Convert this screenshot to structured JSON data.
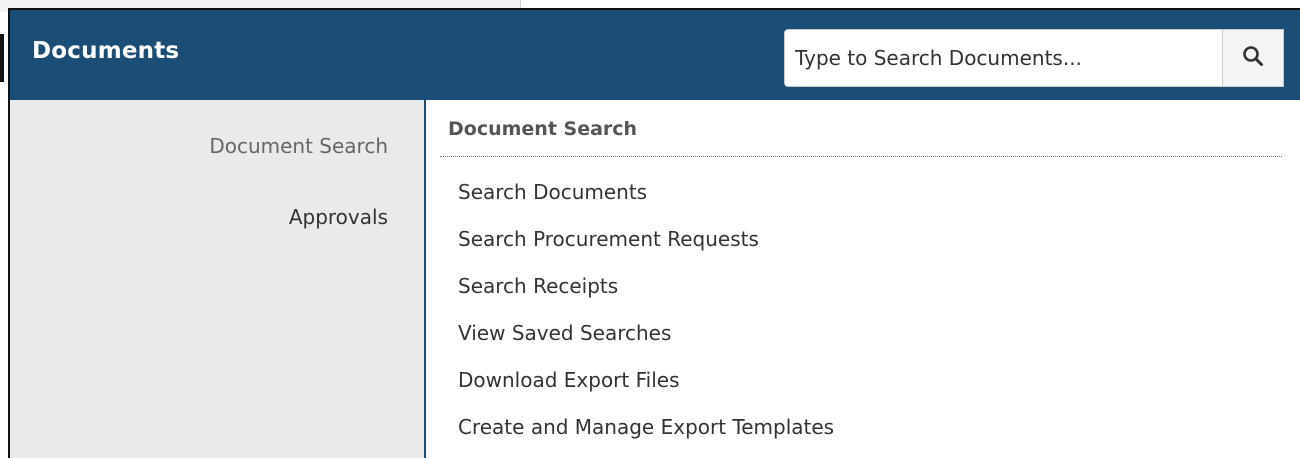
{
  "header": {
    "title": "Documents",
    "background_color": "#1a4e76"
  },
  "search": {
    "placeholder": "Type to Search Documents...",
    "value": "",
    "button_icon": "search-icon"
  },
  "sidebar": {
    "items": [
      {
        "label": "Document Search",
        "active": true
      },
      {
        "label": "Approvals",
        "active": false
      }
    ]
  },
  "content": {
    "section_title": "Document Search",
    "links": [
      "Search Documents",
      "Search Procurement Requests",
      "Search Receipts",
      "View Saved Searches",
      "Download Export Files",
      "Create and Manage Export Templates"
    ]
  }
}
